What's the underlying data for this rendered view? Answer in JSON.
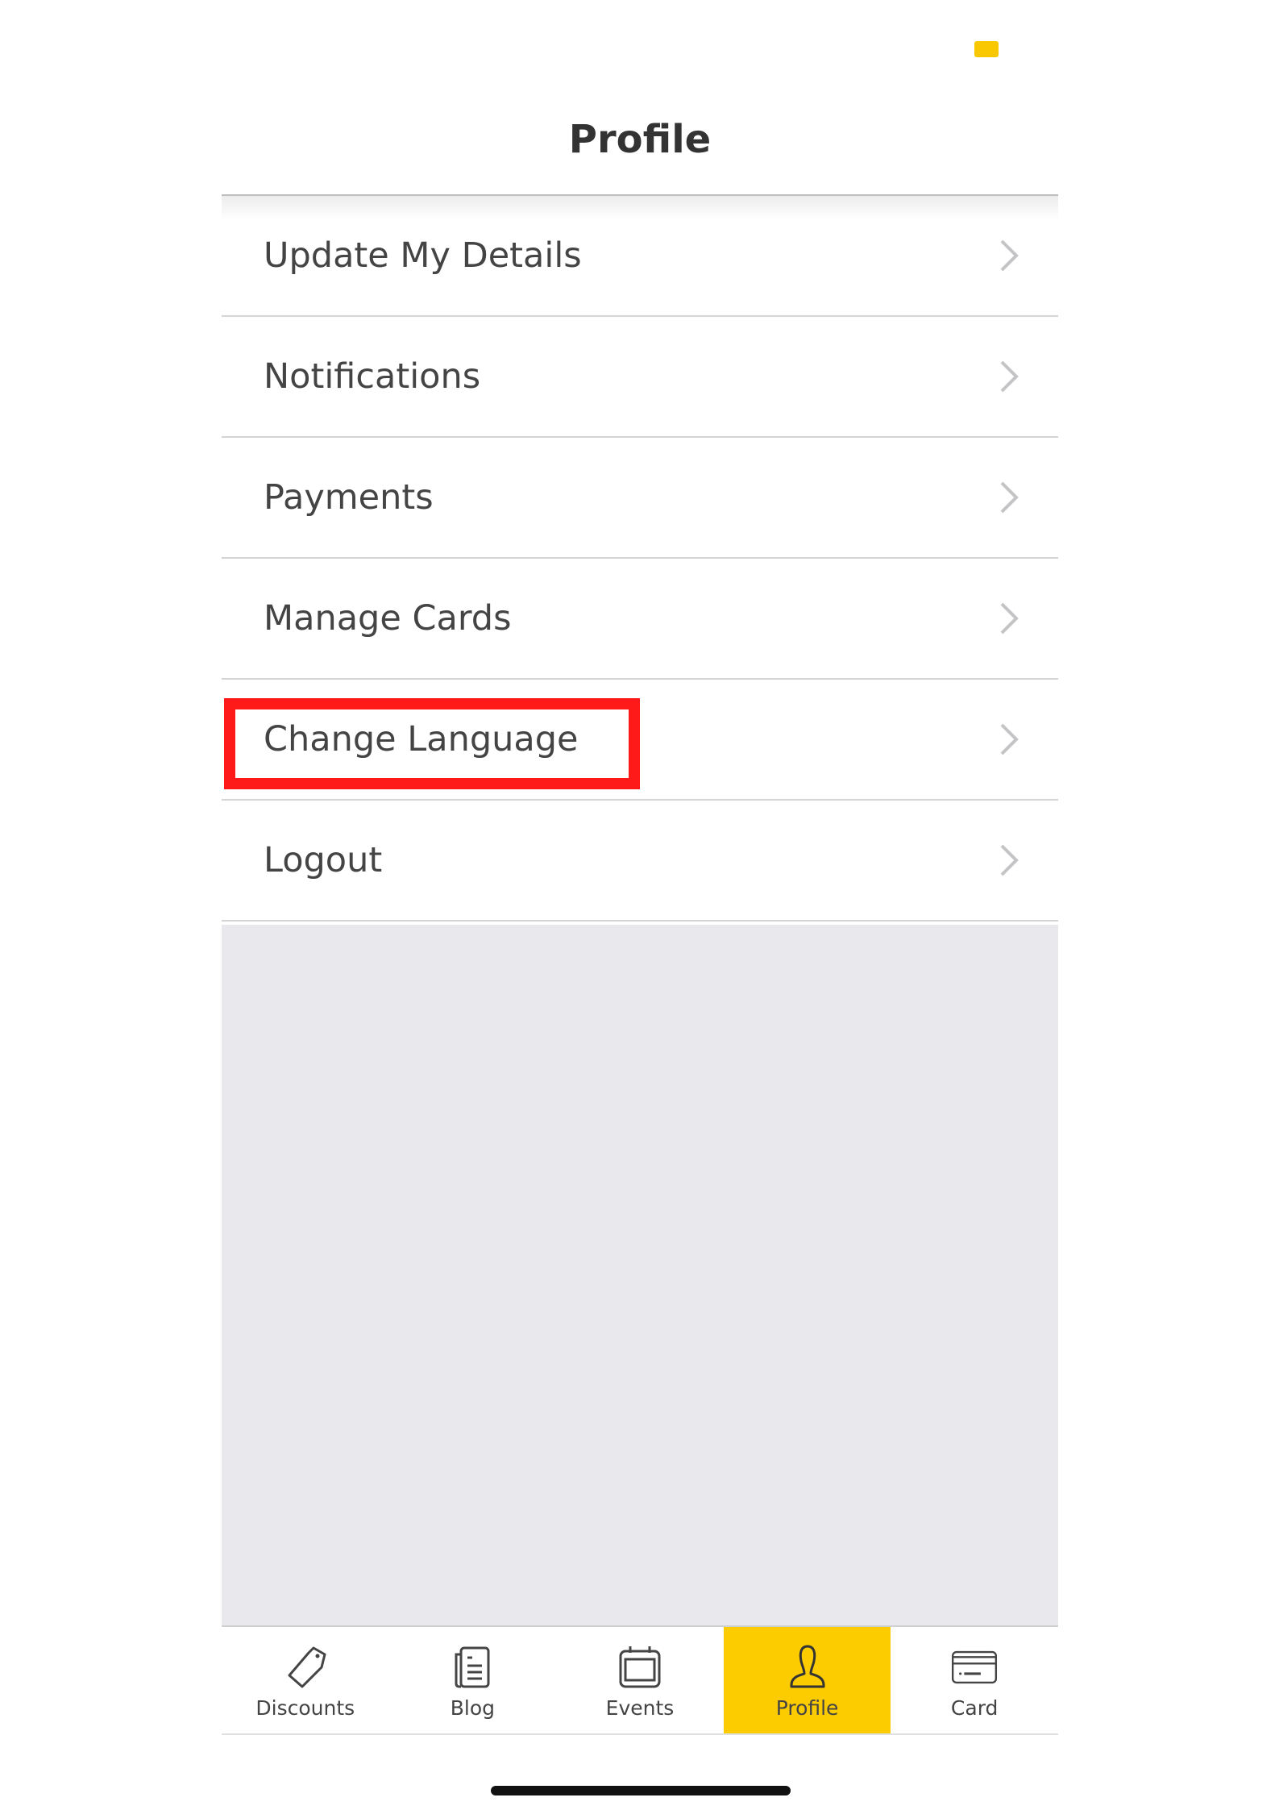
{
  "status_bar": {
    "battery_icon": "battery-icon",
    "battery_color": "#f9c800"
  },
  "header": {
    "title": "Profile"
  },
  "menu": {
    "items": [
      {
        "label": "Update My Details",
        "icon": "chevron-right-icon"
      },
      {
        "label": "Notifications",
        "icon": "chevron-right-icon"
      },
      {
        "label": "Payments",
        "icon": "chevron-right-icon"
      },
      {
        "label": "Manage Cards",
        "icon": "chevron-right-icon"
      },
      {
        "label": "Change Language",
        "icon": "chevron-right-icon",
        "highlighted": true
      },
      {
        "label": "Logout",
        "icon": "chevron-right-icon"
      }
    ]
  },
  "tabbar": {
    "accent_color": "#fccb00",
    "active": "Profile",
    "tabs": [
      {
        "label": "Discounts",
        "icon": "tag-icon"
      },
      {
        "label": "Blog",
        "icon": "newspaper-icon"
      },
      {
        "label": "Events",
        "icon": "calendar-icon"
      },
      {
        "label": "Profile",
        "icon": "person-icon"
      },
      {
        "label": "Card",
        "icon": "credit-card-icon"
      }
    ]
  },
  "annotation": {
    "highlight_color": "#ff1a1a",
    "target": "Change Language"
  }
}
